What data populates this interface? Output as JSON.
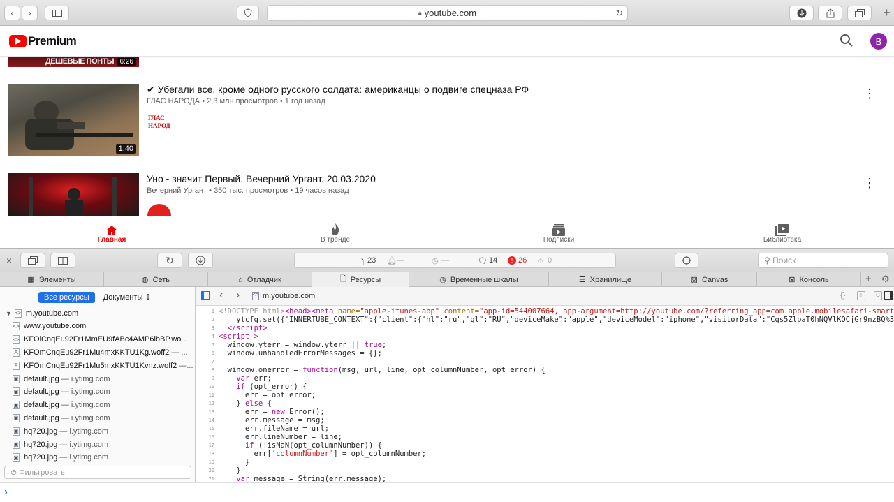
{
  "browser": {
    "url": "youtube.com"
  },
  "youtube": {
    "logo_text": "Premium",
    "avatar_letter": "B",
    "top_partial_video": {
      "overlay_text": "ДЕШЕВЫЕ ПОНТЫ",
      "duration": "6:26"
    },
    "videos": [
      {
        "title": "✔ Убегали все, кроме одного русского солдата: американцы о подвиге спецназа РФ",
        "channel": "ГЛАС НАРОДА",
        "views": "2,3 млн просмотров",
        "age": "1 год назад",
        "duration": "1:40",
        "channel_logo": "ГЛАС НАРОДА"
      },
      {
        "title": "Уно - значит Первый. Вечерний Ургант. 20.03.2020",
        "channel": "Вечерний Ургант",
        "views": "350 тыс. просмотров",
        "age": "19 часов назад"
      }
    ],
    "nav": [
      {
        "label": "Главная",
        "icon": "home-icon",
        "active": true
      },
      {
        "label": "В тренде",
        "icon": "fire-icon",
        "active": false
      },
      {
        "label": "Подписки",
        "icon": "subscriptions-icon",
        "active": false
      },
      {
        "label": "Библиотека",
        "icon": "library-icon",
        "active": false
      }
    ],
    "accent_color": "#ff0000"
  },
  "devtools": {
    "status": {
      "resources": "23",
      "dash1": "—",
      "dash2": "—",
      "logs": "14",
      "errors": "26",
      "warnings": "0"
    },
    "search_placeholder": "Поиск",
    "tabs": [
      "Элементы",
      "Сеть",
      "Отладчик",
      "Ресурсы",
      "Временные шкалы",
      "Хранилище",
      "Canvas",
      "Консоль"
    ],
    "active_tab": "Ресурсы",
    "resource_filter": {
      "all": "Все ресурсы",
      "docs": "Документы"
    },
    "tree": [
      {
        "name": "m.youtube.com",
        "domain": ""
      },
      {
        "name": "www.youtube.com",
        "domain": ""
      },
      {
        "name": "KFOlCnqEu92Fr1MmEU9fABc4AMP6lbBP.wo...",
        "domain": ""
      },
      {
        "name": "KFOmCnqEu92Fr1Mu4mxKKTU1Kg.woff2 —",
        "domain": "..."
      },
      {
        "name": "KFOmCnqEu92Fr1Mu5mxKKTU1Kvnz.woff2",
        "domain": "—..."
      },
      {
        "name": "default.jpg",
        "domain": "— i.ytimg.com"
      },
      {
        "name": "default.jpg",
        "domain": "— i.ytimg.com"
      },
      {
        "name": "default.jpg",
        "domain": "— i.ytimg.com"
      },
      {
        "name": "default.jpg",
        "domain": "— i.ytimg.com"
      },
      {
        "name": "hq720.jpg",
        "domain": "— i.ytimg.com"
      },
      {
        "name": "hq720.jpg",
        "domain": "— i.ytimg.com"
      },
      {
        "name": "hq720.jpg",
        "domain": "— i.ytimg.com"
      }
    ],
    "filter_placeholder": "Фильтровать",
    "code_file": "m.youtube.com",
    "line_numbers": [
      "1",
      "2",
      "3",
      "4",
      "5",
      "6",
      "7",
      "8",
      "9",
      "10",
      "11",
      "12",
      "13",
      "14",
      "15",
      "16",
      "17",
      "18",
      "19",
      "20",
      "21"
    ],
    "console_prompt": "›"
  }
}
